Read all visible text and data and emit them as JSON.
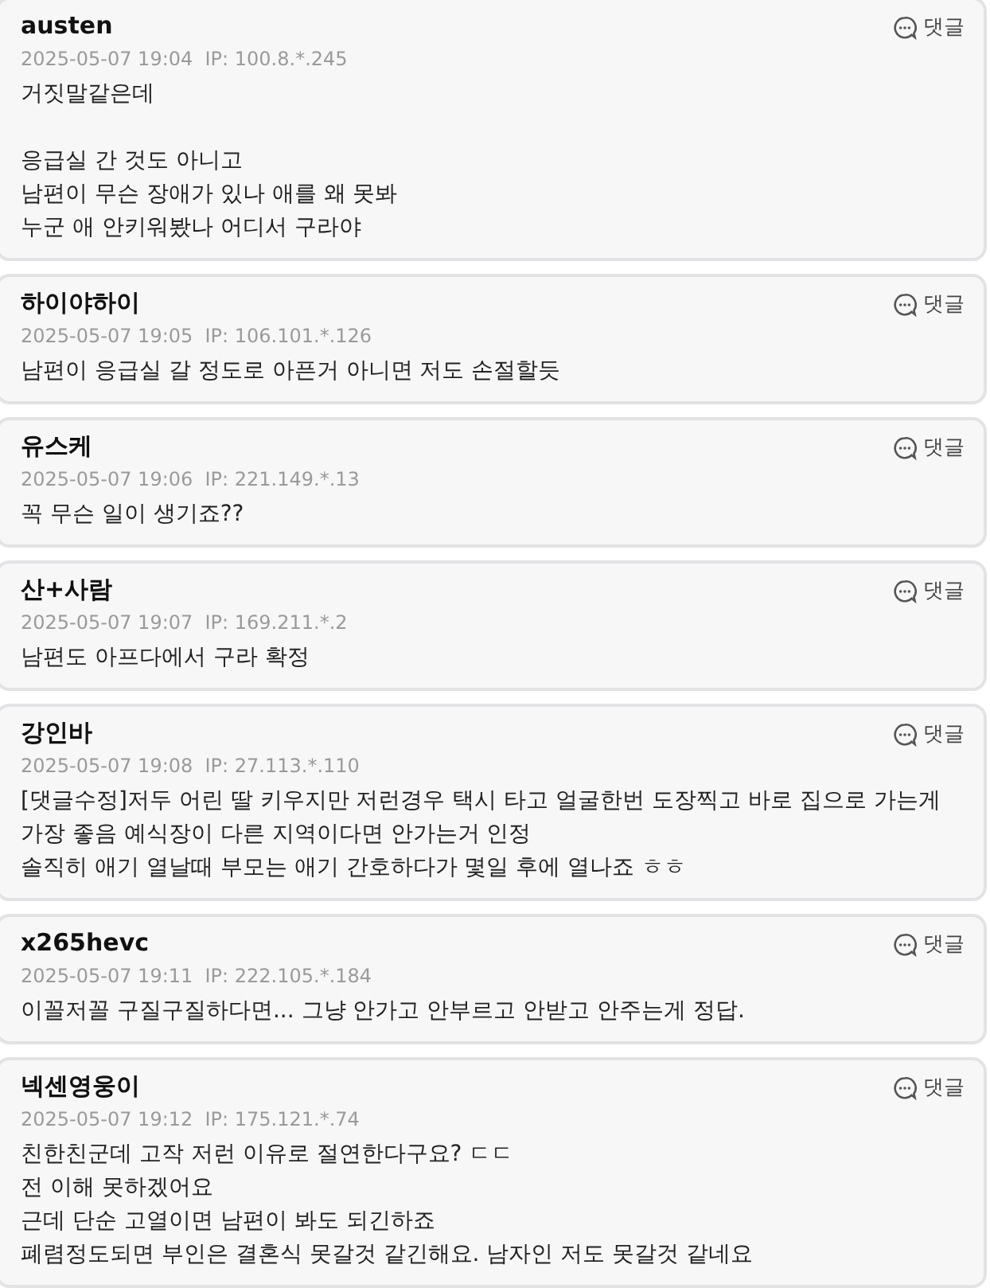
{
  "comments": [
    {
      "author": "austen",
      "meta": "2025-05-07 19:04  IP: 100.8.*.245",
      "body": "거짓말같은데\n\n응급실 간 것도 아니고\n남편이 무슨 장애가 있나 애를 왜 못봐\n누군 애 안키워봤나 어디서 구라야",
      "reply_label": "댓글"
    },
    {
      "author": "하이야하이",
      "meta": "2025-05-07 19:05  IP: 106.101.*.126",
      "body": "남편이 응급실 갈 정도로 아픈거 아니면 저도 손절할듯",
      "reply_label": "댓글"
    },
    {
      "author": "유스케",
      "meta": "2025-05-07 19:06  IP: 221.149.*.13",
      "body": "꼭 무슨 일이 생기죠??",
      "reply_label": "댓글"
    },
    {
      "author": "산+사람",
      "meta": "2025-05-07 19:07  IP: 169.211.*.2",
      "body": "남편도 아프다에서 구라 확정",
      "reply_label": "댓글"
    },
    {
      "author": "강인바",
      "meta": "2025-05-07 19:08  IP: 27.113.*.110",
      "body": "[댓글수정]저두 어린 딸 키우지만 저런경우 택시 타고 얼굴한번 도장찍고 바로 집으로 가는게 가장 좋음 예식장이 다른 지역이다면 안가는거 인정\n솔직히 애기 열날때 부모는 애기 간호하다가 몇일 후에 열나죠 ㅎㅎ",
      "reply_label": "댓글"
    },
    {
      "author": "x265hevc",
      "meta": "2025-05-07 19:11  IP: 222.105.*.184",
      "body": "이꼴저꼴 구질구질하다면... 그냥 안가고 안부르고 안받고 안주는게 정답.",
      "reply_label": "댓글"
    },
    {
      "author": "넥센영웅이",
      "meta": "2025-05-07 19:12  IP: 175.121.*.74",
      "body": "친한친군데 고작 저런 이유로 절연한다구요? ㄷㄷ\n전 이해 못하겠어요\n근데 단순 고열이면 남편이 봐도 되긴하죠\n폐렴정도되면 부인은 결혼식 못갈것 같긴해요. 남자인 저도 못갈것 같네요",
      "reply_label": "댓글"
    }
  ]
}
